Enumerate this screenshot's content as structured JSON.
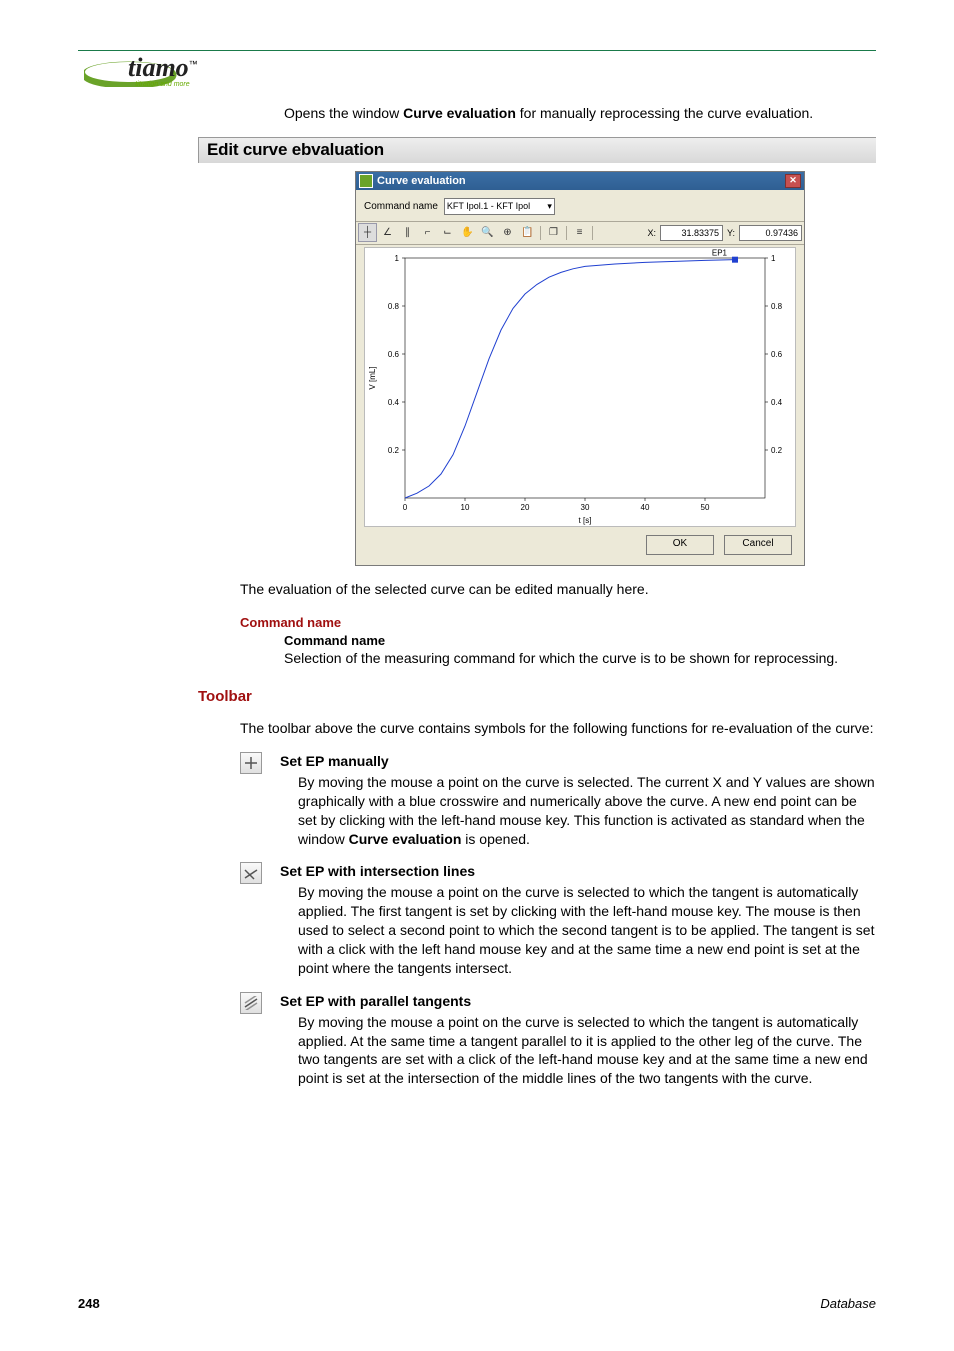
{
  "logo": {
    "name": "tiamo",
    "tm": "™",
    "sub": "titration and more"
  },
  "intro": {
    "pre": "Opens the window ",
    "bold": "Curve evaluation",
    "post": " for manually reprocessing the curve evaluation."
  },
  "section_title": "Edit curve ebvaluation",
  "window": {
    "title": "Curve evaluation",
    "command_label": "Command name",
    "command_value": "KFT Ipol.1 - KFT Ipol",
    "x_label": "X:",
    "x_value": "31.83375",
    "y_label": "Y:",
    "y_value": "0.97436",
    "ok": "OK",
    "cancel": "Cancel"
  },
  "chart_data": {
    "type": "line",
    "xlabel": "t [s]",
    "ylabel": "V [mL]",
    "xlim": [
      0,
      60
    ],
    "ylim": [
      0,
      1
    ],
    "x_ticks": [
      0,
      10,
      20,
      30,
      40,
      50
    ],
    "y_ticks_left": [
      0.2,
      0.4,
      0.6,
      0.8,
      1
    ],
    "y_ticks_right": [
      0.2,
      0.4,
      0.6,
      0.8,
      1
    ],
    "annotation": "EP1",
    "series": [
      {
        "name": "curve",
        "x": [
          0,
          2,
          4,
          6,
          8,
          10,
          12,
          14,
          16,
          18,
          20,
          22,
          24,
          26,
          28,
          30,
          35,
          40,
          50,
          55
        ],
        "y": [
          0.0,
          0.02,
          0.05,
          0.1,
          0.18,
          0.3,
          0.44,
          0.58,
          0.7,
          0.79,
          0.85,
          0.89,
          0.92,
          0.94,
          0.955,
          0.965,
          0.975,
          0.982,
          0.99,
          0.993
        ]
      }
    ]
  },
  "caption": "The evaluation of the selected curve can be edited manually here.",
  "cmd_block": {
    "hdr": "Command name",
    "sub": "Command name",
    "body": "Selection of the measuring command for which the curve is to be shown for reprocessing."
  },
  "toolbar_hdr": "Toolbar",
  "toolbar_intro": "The toolbar above the curve contains symbols for the following functions for re-evaluation of the curve:",
  "tools": [
    {
      "icon": "plus",
      "title": "Set EP manually",
      "body_pre": "By moving the mouse a point on the curve is selected. The current X and Y values are shown graphically with a blue crosswire and numerically above the curve. A new end point can be set by clicking with the left-hand mouse key. This function is activated as standard when the window ",
      "body_bold": "Curve evaluation",
      "body_post": " is opened."
    },
    {
      "icon": "intersect",
      "title": "Set EP with intersection lines",
      "body_pre": "By moving the mouse a point on the curve is selected to which the tangent is automatically applied. The first tangent is set by clicking with the left-hand mouse key. The mouse is then used to select a second point to which the second tangent is to be applied. The tangent is set with a click with the left hand mouse key and at the same time a new end point is set at the point where the tangents intersect.",
      "body_bold": "",
      "body_post": ""
    },
    {
      "icon": "parallel",
      "title": "Set EP with parallel tangents",
      "body_pre": "By moving the mouse a point on the curve is selected to which the tangent is automatically applied. At the same time a tangent parallel to it is applied to the other leg of the curve. The two tangents are set with a click of the left-hand mouse key and at the same time a new end point is set at the intersection of the middle lines of the two tangents with the curve.",
      "body_bold": "",
      "body_post": ""
    }
  ],
  "footer": {
    "page": "248",
    "section": "Database"
  }
}
